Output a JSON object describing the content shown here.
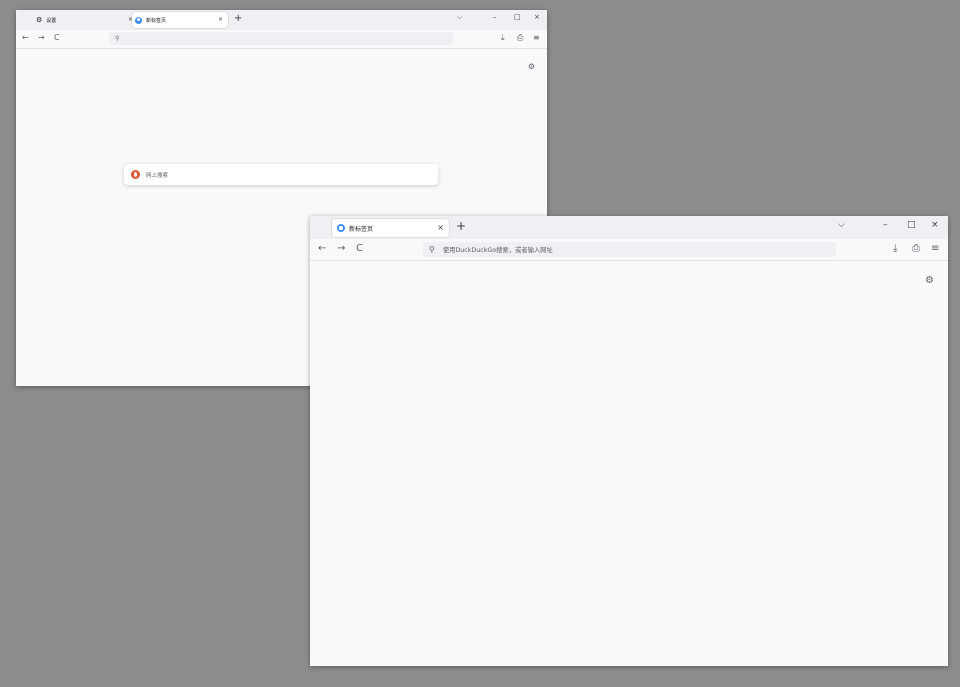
{
  "back_window": {
    "tabs": [
      {
        "label": "设置",
        "active": false,
        "icon": "gear-icon"
      },
      {
        "label": "新标签页",
        "active": true,
        "icon": "firefox-icon"
      }
    ],
    "search_box": {
      "placeholder": "网上搜索",
      "engine_icon": "duckduckgo-icon"
    }
  },
  "front_window": {
    "tabs": [
      {
        "label": "新标签页",
        "active": true,
        "icon": "firefox-icon"
      }
    ],
    "urlbar": {
      "placeholder": "使用DuckDuckGo搜索，或者输入网址"
    }
  },
  "glyphs": {
    "close": "×",
    "new_tab": "+",
    "list_all": "⌵",
    "minimize": "–",
    "maximize": "□",
    "win_close": "×",
    "back": "←",
    "forward": "→",
    "reload": "C",
    "search": "⚲",
    "download": "⤓",
    "extensions": "⎙",
    "menu": "≡",
    "gear": "⚙"
  },
  "colors": {
    "desktop": "#8c8c8c",
    "tabbar": "#f0f0f4",
    "toolbar": "#f9f9fb",
    "accent": "#3c8ef0",
    "ddg": "#de5833"
  }
}
